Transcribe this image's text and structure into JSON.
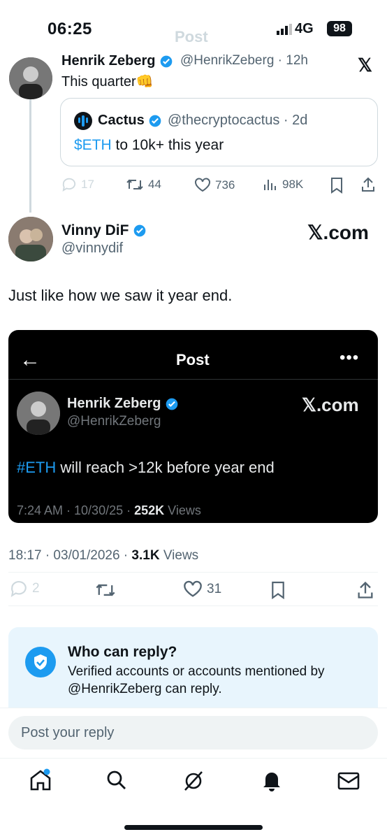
{
  "status_bar": {
    "time": "06:25",
    "network": "4G",
    "battery": "98"
  },
  "header": {
    "title": "Post"
  },
  "parent_post": {
    "author_name": "Henrik Zeberg",
    "author_handle": "@HenrikZeberg · 12h",
    "text": "This quarter👊",
    "quote": {
      "author_name": "Cactus",
      "author_handle": "@thecryptocactus · 2d",
      "cashtag": "$ETH",
      "text": " to 10k+ this year"
    },
    "stats": {
      "replies": "17",
      "reposts": "44",
      "likes": "736",
      "views": "98K"
    }
  },
  "main_post": {
    "author_name": "Vinny DiF",
    "author_handle": "@vinnydif",
    "source_label": "𝕏.com",
    "text": "Just like how we saw it year end.",
    "embedded_screenshot": {
      "header_title": "Post",
      "author_name": "Henrik Zeberg",
      "author_handle": "@HenrikZeberg",
      "source_label": "𝕏.com",
      "hashtag": "#ETH",
      "text": " will reach >12k before year end",
      "timestamp": "7:24 AM · 10/30/25 · ",
      "views_count": "252K",
      "views_label": " Views"
    },
    "timestamp": "18:17 · 03/01/2026 · ",
    "views_count": "3.1K",
    "views_label": " Views",
    "stats": {
      "replies": "2",
      "likes": "31"
    }
  },
  "who_can_reply": {
    "title": "Who can reply?",
    "body": "Verified accounts or accounts mentioned by @HenrikZeberg can reply."
  },
  "reply": {
    "placeholder": "Post your reply"
  },
  "colors": {
    "accent": "#1d9bf0",
    "text": "#0f1419",
    "secondary": "#536471"
  },
  "nav": {
    "items": [
      "home-icon",
      "search-icon",
      "grok-icon",
      "notifications-icon",
      "messages-icon"
    ]
  }
}
